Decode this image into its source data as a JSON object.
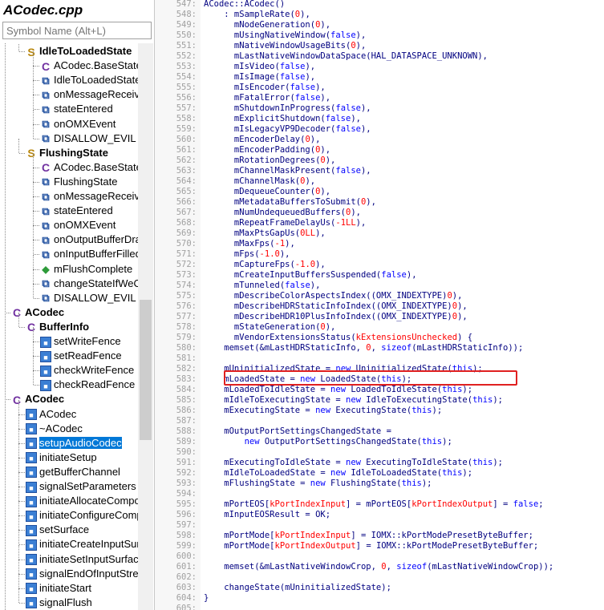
{
  "file_title": "ACodec.cpp",
  "search": {
    "placeholder": "Symbol Name (Alt+L)"
  },
  "tree": [
    {
      "label": "IdleToLoadedState",
      "icon": "struct-icon",
      "bold": true,
      "depth": 1
    },
    {
      "label": "ACodec.BaseState",
      "icon": "class-icon",
      "depth": 2
    },
    {
      "label": "IdleToLoadedState",
      "icon": "member-icon",
      "depth": 2
    },
    {
      "label": "onMessageReceived",
      "icon": "member-icon",
      "depth": 2
    },
    {
      "label": "stateEntered",
      "icon": "member-icon",
      "depth": 2
    },
    {
      "label": "onOMXEvent",
      "icon": "member-icon",
      "depth": 2
    },
    {
      "label": "DISALLOW_EVIL",
      "icon": "member-icon",
      "depth": 2
    },
    {
      "label": "FlushingState",
      "icon": "struct-icon",
      "bold": true,
      "depth": 1
    },
    {
      "label": "ACodec.BaseState",
      "icon": "class-icon",
      "depth": 2
    },
    {
      "label": "FlushingState",
      "icon": "member-icon",
      "depth": 2
    },
    {
      "label": "onMessageReceived",
      "icon": "member-icon",
      "depth": 2
    },
    {
      "label": "stateEntered",
      "icon": "member-icon",
      "depth": 2
    },
    {
      "label": "onOMXEvent",
      "icon": "member-icon",
      "depth": 2
    },
    {
      "label": "onOutputBufferDrained",
      "icon": "member-icon",
      "depth": 2
    },
    {
      "label": "onInputBufferFilled",
      "icon": "member-icon",
      "depth": 2
    },
    {
      "label": "mFlushComplete",
      "icon": "variable-icon",
      "depth": 2
    },
    {
      "label": "changeStateIfWeOwnAllBuffers",
      "icon": "member-icon",
      "depth": 2
    },
    {
      "label": "DISALLOW_EVIL",
      "icon": "member-icon",
      "depth": 2
    },
    {
      "label": "ACodec",
      "icon": "class-icon",
      "bold": true,
      "depth": 0
    },
    {
      "label": "BufferInfo",
      "icon": "class-icon",
      "bold": true,
      "depth": 1
    },
    {
      "label": "setWriteFence",
      "icon": "method-icon",
      "depth": 2
    },
    {
      "label": "setReadFence",
      "icon": "method-icon",
      "depth": 2
    },
    {
      "label": "checkWriteFence",
      "icon": "method-icon",
      "depth": 2
    },
    {
      "label": "checkReadFence",
      "icon": "method-icon",
      "depth": 2
    },
    {
      "label": "ACodec",
      "icon": "class-icon",
      "bold": true,
      "depth": 0
    },
    {
      "label": "ACodec",
      "icon": "method-icon",
      "depth": 1
    },
    {
      "label": "~ACodec",
      "icon": "method-icon",
      "depth": 1
    },
    {
      "label": "setupAudioCodec",
      "icon": "method-icon",
      "depth": 1,
      "selected": true
    },
    {
      "label": "initiateSetup",
      "icon": "method-icon",
      "depth": 1
    },
    {
      "label": "getBufferChannel",
      "icon": "method-icon",
      "depth": 1
    },
    {
      "label": "signalSetParameters",
      "icon": "method-icon",
      "depth": 1
    },
    {
      "label": "initiateAllocateComponent",
      "icon": "method-icon",
      "depth": 1
    },
    {
      "label": "initiateConfigureComponent",
      "icon": "method-icon",
      "depth": 1
    },
    {
      "label": "setSurface",
      "icon": "method-icon",
      "depth": 1
    },
    {
      "label": "initiateCreateInputSurface",
      "icon": "method-icon",
      "depth": 1
    },
    {
      "label": "initiateSetInputSurface",
      "icon": "method-icon",
      "depth": 1
    },
    {
      "label": "signalEndOfInputStream",
      "icon": "method-icon",
      "depth": 1
    },
    {
      "label": "initiateStart",
      "icon": "method-icon",
      "depth": 1
    },
    {
      "label": "signalFlush",
      "icon": "method-icon",
      "depth": 1
    }
  ],
  "code": {
    "first_line": 547,
    "highlighted_line": 583,
    "lines": [
      "ACodec::ACodec()",
      "    : mSampleRate(0),",
      "      mNodeGeneration(0),",
      "      mUsingNativeWindow(false),",
      "      mNativeWindowUsageBits(0),",
      "      mLastNativeWindowDataSpace(HAL_DATASPACE_UNKNOWN),",
      "      mIsVideo(false),",
      "      mIsImage(false),",
      "      mIsEncoder(false),",
      "      mFatalError(false),",
      "      mShutdownInProgress(false),",
      "      mExplicitShutdown(false),",
      "      mIsLegacyVP9Decoder(false),",
      "      mEncoderDelay(0),",
      "      mEncoderPadding(0),",
      "      mRotationDegrees(0),",
      "      mChannelMaskPresent(false),",
      "      mChannelMask(0),",
      "      mDequeueCounter(0),",
      "      mMetadataBuffersToSubmit(0),",
      "      mNumUndequeuedBuffers(0),",
      "      mRepeatFrameDelayUs(-1LL),",
      "      mMaxPtsGapUs(0LL),",
      "      mMaxFps(-1),",
      "      mFps(-1.0),",
      "      mCaptureFps(-1.0),",
      "      mCreateInputBuffersSuspended(false),",
      "      mTunneled(false),",
      "      mDescribeColorAspectsIndex((OMX_INDEXTYPE)0),",
      "      mDescribeHDRStaticInfoIndex((OMX_INDEXTYPE)0),",
      "      mDescribeHDR10PlusInfoIndex((OMX_INDEXTYPE)0),",
      "      mStateGeneration(0),",
      "      mVendorExtensionsStatus(kExtensionsUnchecked) {",
      "    memset(&mLastHDRStaticInfo, 0, sizeof(mLastHDRStaticInfo));",
      "",
      "    mUninitializedState = new UninitializedState(this);",
      "    mLoadedState = new LoadedState(this);",
      "    mLoadedToIdleState = new LoadedToIdleState(this);",
      "    mIdleToExecutingState = new IdleToExecutingState(this);",
      "    mExecutingState = new ExecutingState(this);",
      "",
      "    mOutputPortSettingsChangedState =",
      "        new OutputPortSettingsChangedState(this);",
      "",
      "    mExecutingToIdleState = new ExecutingToIdleState(this);",
      "    mIdleToLoadedState = new IdleToLoadedState(this);",
      "    mFlushingState = new FlushingState(this);",
      "",
      "    mPortEOS[kPortIndexInput] = mPortEOS[kPortIndexOutput] = false;",
      "    mInputEOSResult = OK;",
      "",
      "    mPortMode[kPortIndexInput] = IOMX::kPortModePresetByteBuffer;",
      "    mPortMode[kPortIndexOutput] = IOMX::kPortModePresetByteBuffer;",
      "",
      "    memset(&mLastNativeWindowCrop, 0, sizeof(mLastNativeWindowCrop));",
      "",
      "    changeState(mUninitializedState);",
      "}",
      ""
    ]
  },
  "colors": {
    "selection": "#0078d7",
    "code_default": "#000080",
    "number": "#ff0000",
    "keyword": "#0000ff",
    "highlight_box": "#e02020"
  }
}
